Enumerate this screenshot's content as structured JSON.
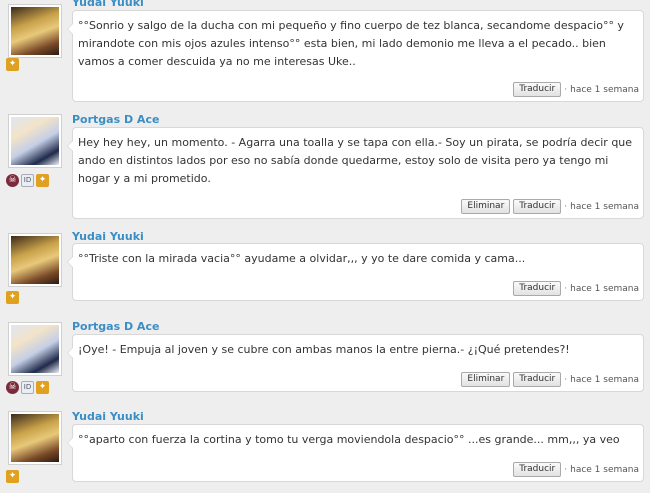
{
  "ui": {
    "translate_label": "Traducir",
    "delete_label": "Eliminar",
    "separator": "·"
  },
  "comments": [
    {
      "author": "Yudai Yuuki",
      "text": "°°Sonrio y salgo de la ducha con mi pequeño y fino cuerpo de tez blanca, secandome despacio°° y mirandote con mis ojos azules intenso°° esta bien, mi lado demonio me lleva a el pecado.. bien vamos a comer descuida ya no me interesas Uke..",
      "time": "hace 1 semana",
      "avatar_icon": "avatar-yudai-yuuki-icon"
    },
    {
      "author": "Portgas D Ace",
      "text": "Hey hey hey, un momento. - Agarra una toalla y se tapa con ella.- Soy un pirata, se podría decir que ando en distintos lados por eso no sabía donde quedarme, estoy solo de visita pero ya tengo mi hogar y a mi prometido.",
      "time": "hace 1 semana",
      "avatar_icon": "avatar-portgas-d-ace-icon"
    },
    {
      "author": "Yudai Yuuki",
      "text": "°°Triste con la mirada vacia°° ayudame a olvidar,,, y yo te dare comida y cama...",
      "time": "hace 1 semana",
      "avatar_icon": "avatar-yudai-yuuki-icon"
    },
    {
      "author": "Portgas D Ace",
      "text": "¡Oye! - Empuja al joven y se cubre con ambas manos la entre pierna.- ¿¡Qué pretendes?!",
      "time": "hace 1 semana",
      "avatar_icon": "avatar-portgas-d-ace-icon"
    },
    {
      "author": "Yudai Yuuki",
      "text": "°°aparto con fuerza la cortina y tomo tu verga moviendola despacio°° ...es grande... mm,,, ya veo",
      "time": "hace 1 semana",
      "avatar_icon": "avatar-yudai-yuuki-icon"
    }
  ]
}
